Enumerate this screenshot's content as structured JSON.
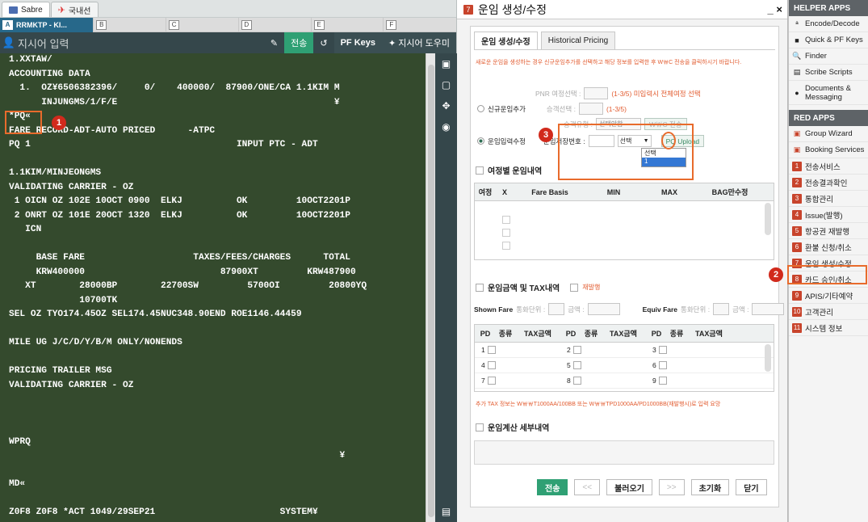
{
  "terminal": {
    "tabs": [
      {
        "label": "Sabre"
      },
      {
        "label": "국내선"
      }
    ],
    "pcc_cells": [
      {
        "letter": "A",
        "text": "RRMKTP - KI..."
      },
      {
        "letter": "B",
        "text": ""
      },
      {
        "letter": "C",
        "text": ""
      },
      {
        "letter": "D",
        "text": ""
      },
      {
        "letter": "E",
        "text": ""
      },
      {
        "letter": "F",
        "text": ""
      }
    ],
    "command_placeholder": "지시어 입력",
    "send_label": "전송",
    "pf_keys_label": "PF Keys",
    "help_label": "지시어 도우미",
    "lines": [
      "1.XXTAW/",
      "ACCOUNTING DATA",
      "  1.  OZ¥6506382396/     0/    400000/  87900/ONE/CA 1.1KIM M",
      "      INJUNGMS/1/F/E                                        ¥",
      "*PQ«",
      "FARE RECORD-ADT-AUTO PRICED      -ATPC",
      "PQ 1                                      INPUT PTC - ADT",
      "",
      "1.1KIM/MINJEONGMS",
      "VALIDATING CARRIER - OZ",
      " 1 OICN OZ 102E 10OCT 0900  ELKJ          OK         10OCT2201P",
      " 2 ONRT OZ 101E 20OCT 1320  ELKJ          OK         10OCT2201P",
      "   ICN",
      "",
      "     BASE FARE                    TAXES/FEES/CHARGES      TOTAL",
      "     KRW400000                         87900XT         KRW487900",
      "   XT        28000BP        22700SW         5700OI         20800YQ",
      "             10700TK",
      "SEL OZ TYO174.45OZ SEL174.45NUC348.90END ROE1146.44459",
      "",
      "MILE UG J/C/D/Y/B/M ONLY/NONENDS",
      "",
      "PRICING TRAILER MSG",
      "VALIDATING CARRIER - OZ",
      "",
      "",
      "",
      "WPRQ",
      "                                                             ¥",
      "",
      "MD«",
      "",
      "Z0F8 Z0F8 *ACT 1049/29SEP21                       SYSTEM¥"
    ],
    "markers": [
      "1"
    ]
  },
  "dialog": {
    "number": "7",
    "title": "운임 생성/수정",
    "close": "×",
    "minimize": "_",
    "tabs": [
      "운임 생성/수정",
      "Historical Pricing"
    ],
    "notice": "새로운 운임을 생성하는 경우 신규운임추가를 선택하고 해당 정보를 입력한 후 W￦C 전송을 클릭하시기 바랍니다.",
    "pnr_label": "PNR 여정선택 :",
    "pnr_hint": "(1-3/5) 미입력시 전체여정 선택",
    "new_fare_label": "신규운임추가",
    "seg_label": "승객선택 :",
    "seg_hint": "(1-3/5)",
    "fare_type_label": "승객유형 :",
    "fare_type_value": "선택안함",
    "wc_send": "W￦C 전송",
    "fare_edit_label": "운임입력수정",
    "fare_store_label": "운임저장번호 :",
    "select_label": "선택",
    "dropdown_options": [
      "선택",
      "1"
    ],
    "pq_upload": "PQ Upload",
    "marker": "3",
    "section1": "여정별 운임내역",
    "grid1_headers": [
      "여정",
      "X",
      "Fare Basis",
      "MIN",
      "MAX",
      "BAG만수정"
    ],
    "section2": "운임금액 및 TAX내역",
    "reissue": "재발행",
    "shown_fare": "Shown Fare",
    "currency_label": "통화단위 :",
    "amount_label": "금액 :",
    "equiv_fare": "Equiv Fare",
    "grid2_headers": [
      "PD",
      "종류",
      "TAX금액",
      "PD",
      "종류",
      "TAX금액",
      "PD",
      "종류",
      "TAX금액"
    ],
    "grid2_pd": [
      "1",
      "2",
      "3",
      "4",
      "5",
      "6",
      "7",
      "8",
      "9"
    ],
    "tax_note": "추가 TAX 정보는 W￦￦T1000AA/100BB 또는 W￦￦TPD1000AA/PD1000BB(재발행시)로 입력 요망",
    "section3": "운임계산 세부내역",
    "buttons": {
      "send": "전송",
      "prev": "<<",
      "load": "불러오기",
      "next": ">>",
      "reset": "초기화",
      "close": "닫기"
    }
  },
  "sidebar": {
    "helper_title": "HELPER APPS",
    "helper_items": [
      {
        "label": "Encode/Decode",
        "icon": "translate-icon"
      },
      {
        "label": "Quick & PF Keys",
        "icon": "keyboard-icon"
      },
      {
        "label": "Finder",
        "icon": "search-icon"
      },
      {
        "label": "Scribe Scripts",
        "icon": "script-icon"
      },
      {
        "label": "Documents & Messaging",
        "icon": "pin-icon"
      }
    ],
    "red_title": "RED APPS",
    "red_items": [
      {
        "label": "Group Wizard",
        "icon": "group-icon"
      },
      {
        "label": "Booking Services",
        "icon": "booking-icon"
      }
    ],
    "numbered_items": [
      {
        "num": "1",
        "label": "전송서비스"
      },
      {
        "num": "2",
        "label": "전송결과확인"
      },
      {
        "num": "3",
        "label": "통합관리"
      },
      {
        "num": "4",
        "label": "Issue(발행)"
      },
      {
        "num": "5",
        "label": "항공권 재발행"
      },
      {
        "num": "6",
        "label": "환불 신청/취소"
      },
      {
        "num": "7",
        "label": "운임 생성/수정"
      },
      {
        "num": "8",
        "label": "카드 승인/취소"
      },
      {
        "num": "9",
        "label": "APIS/기타예약"
      },
      {
        "num": "10",
        "label": "고객관리"
      },
      {
        "num": "11",
        "label": "시스템 정보"
      }
    ],
    "marker": "2"
  }
}
